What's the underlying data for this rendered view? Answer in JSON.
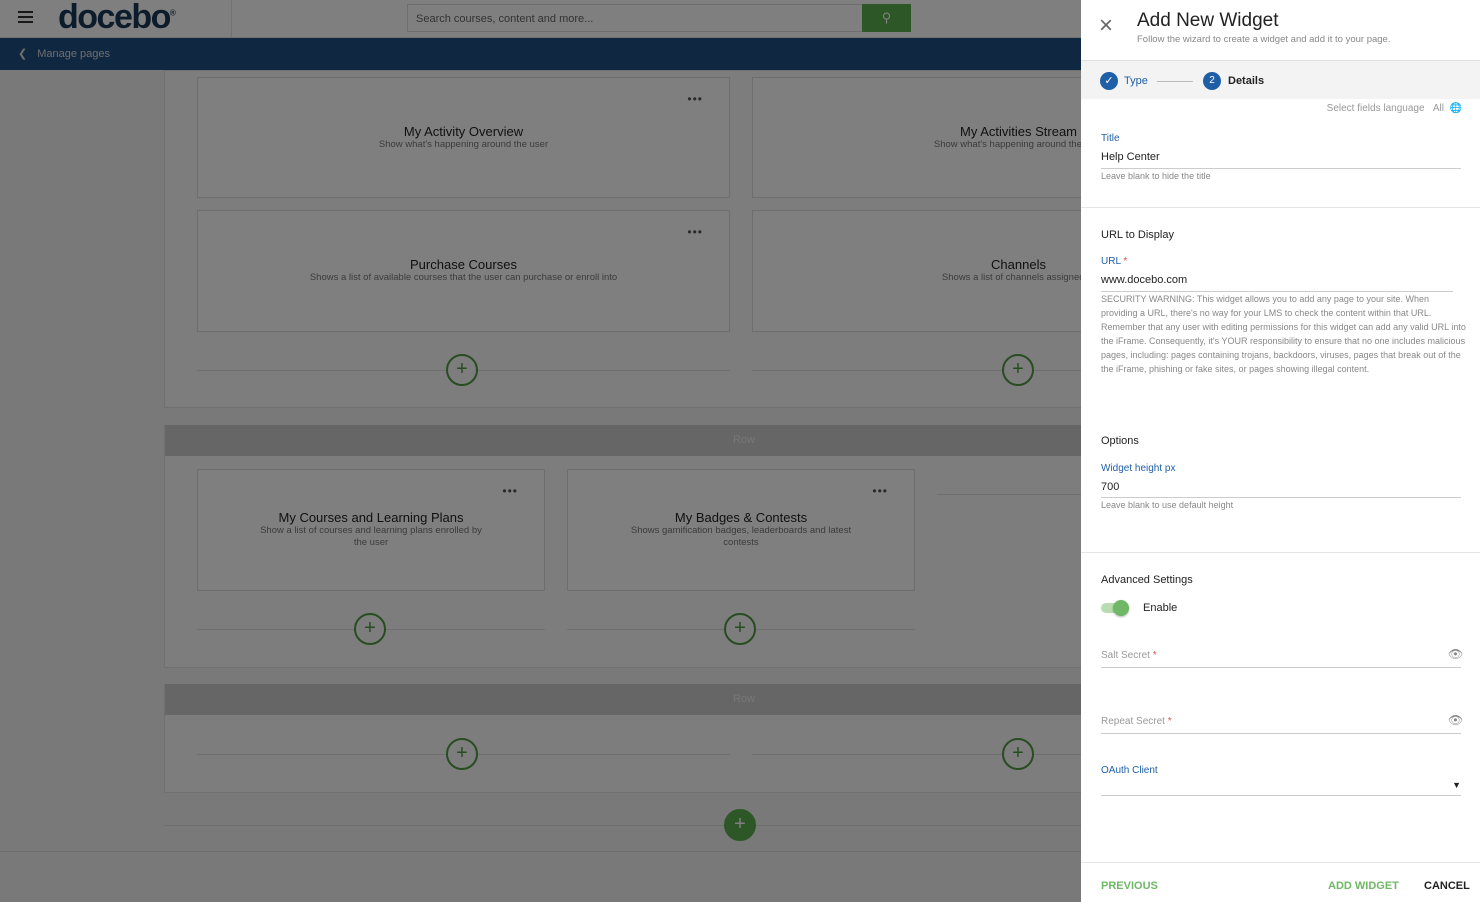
{
  "header": {
    "logo": "docebo",
    "search_placeholder": "Search courses, content and more..."
  },
  "subbar": {
    "back_label": "Manage pages"
  },
  "canvas": {
    "row_label": "Row",
    "cards": [
      {
        "title": "My Activity Overview",
        "desc": "Show what's happening around the user"
      },
      {
        "title": "My Activities Stream",
        "desc": "Show what's happening around the user"
      },
      {
        "title": "Purchase Courses",
        "desc": "Shows a list of available courses that the user can purchase or enroll into"
      },
      {
        "title": "Channels",
        "desc": "Shows a list of channels assigned to"
      },
      {
        "title": "My Courses and Learning Plans",
        "desc": "Show a list of courses and learning plans enrolled by the user"
      },
      {
        "title": "My Badges & Contests",
        "desc": "Shows gamification badges, leaderboards and latest contests"
      }
    ],
    "more": "•••",
    "plus": "+"
  },
  "panel": {
    "title": "Add New Widget",
    "subtitle": "Follow the wizard to create a widget and add it to your page.",
    "steps": [
      {
        "label": "Type",
        "state": "done"
      },
      {
        "number": "2",
        "label": "Details",
        "state": "active"
      }
    ],
    "language_label": "Select fields language",
    "language_value": "All",
    "title_field": {
      "label": "Title",
      "value": "Help Center",
      "help": "Leave blank to hide the title"
    },
    "url_section": {
      "heading": "URL to Display",
      "label": "URL",
      "required": "*",
      "value": "www.docebo.com",
      "warning": "SECURITY WARNING: This widget allows you to add any page to your site. When providing a URL, there's no way for your LMS to check the content within that URL. Remember that any user with editing permissions for this widget can add any valid URL into the iFrame. Consequently, it's YOUR responsibility to ensure that no one includes malicious pages, including: pages containing trojans, backdoors, viruses, pages that break out of the the iFrame, phishing or fake sites, or pages showing illegal content."
    },
    "options": {
      "heading": "Options",
      "label": "Widget height px",
      "value": "700",
      "help": "Leave blank to use default height"
    },
    "advanced": {
      "heading": "Advanced Settings",
      "toggle_label": "Enable",
      "toggle_on": true,
      "salt_label": "Salt Secret",
      "repeat_label": "Repeat Secret",
      "required": "*",
      "oauth_label": "OAuth Client"
    },
    "footer": {
      "previous": "PREVIOUS",
      "add": "ADD WIDGET",
      "cancel": "CANCEL"
    },
    "colors": {
      "accent": "#1f5fa8",
      "green": "#5aaf4d"
    }
  }
}
